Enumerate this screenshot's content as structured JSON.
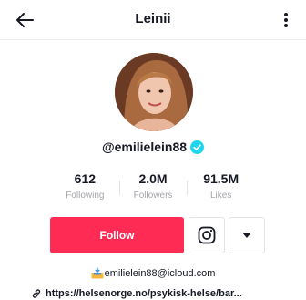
{
  "header": {
    "title": "Leinii",
    "back_icon": "back-arrow-icon",
    "more_icon": "more-vertical-icon"
  },
  "profile": {
    "handle": "@emilielein88",
    "verified": true
  },
  "stats": [
    {
      "value": "612",
      "label": "Following"
    },
    {
      "value": "2.0M",
      "label": "Followers"
    },
    {
      "value": "91.5M",
      "label": "Likes"
    }
  ],
  "actions": {
    "follow_label": "Follow",
    "instagram_icon": "instagram-icon",
    "dropdown_icon": "caret-down-icon"
  },
  "bio": {
    "email": "emilielein88@icloud.com",
    "link": "https://helsenorge.no/psykisk-helse/bar..."
  },
  "colors": {
    "accent": "#fe2c55",
    "verified": "#20d5ec",
    "text": "#161823",
    "muted": "#a5a6ab"
  }
}
